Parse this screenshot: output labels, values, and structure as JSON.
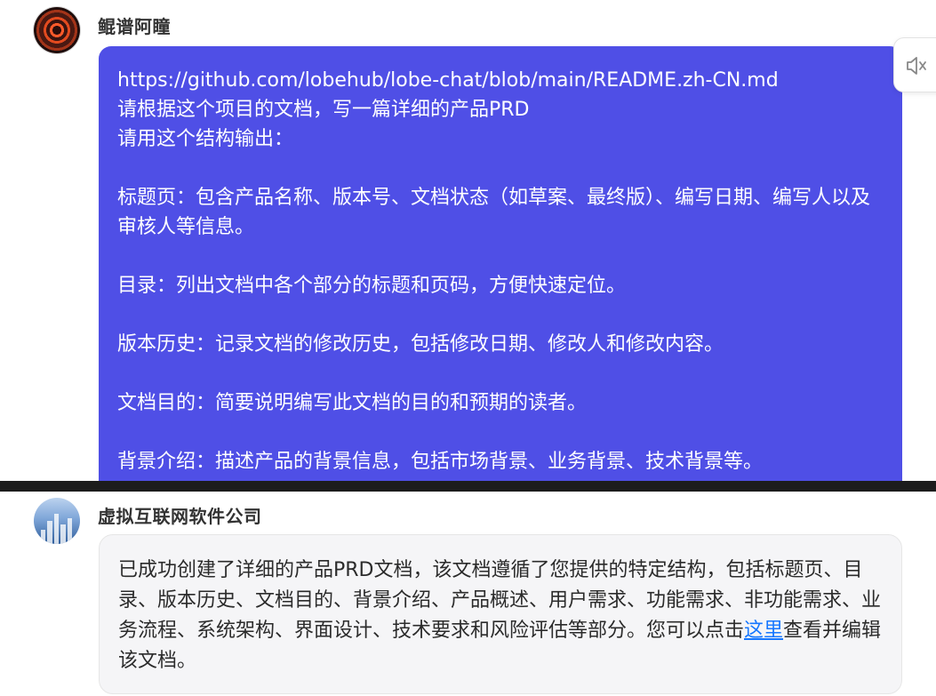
{
  "conversation": {
    "user_message": {
      "sender_name": "鲲谱阿瞳",
      "avatar": "swirl-avatar",
      "lines": [
        "https://github.com/lobehub/lobe-chat/blob/main/README.zh-CN.md",
        "请根据这个项目的文档，写一篇详细的产品PRD",
        "请用这个结构输出：",
        "",
        "标题页：包含产品名称、版本号、文档状态（如草案、最终版）、编写日期、编写人以及审核人等信息。",
        "",
        "目录：列出文档中各个部分的标题和页码，方便快速定位。",
        "",
        "版本历史：记录文档的修改历史，包括修改日期、修改人和修改内容。",
        "",
        "文档目的：简要说明编写此文档的目的和预期的读者。",
        "",
        "背景介绍：描述产品的背景信息，包括市场背景、业务背景、技术背景等。"
      ]
    },
    "side_action": {
      "icon": "speaker-icon"
    },
    "assistant_message": {
      "sender_name": "虚拟互联网软件公司",
      "avatar": "city-skyline-avatar",
      "text_before_link": "已成功创建了详细的产品PRD文档，该文档遵循了您提供的特定结构，包括标题页、目录、版本历史、文档目的、背景介绍、产品概述、用户需求、功能需求、非功能需求、业务流程、系统架构、界面设计、技术要求和风险评估等部分。您可以点击",
      "link_text": "这里",
      "text_after_link": "查看并编辑该文档。"
    }
  },
  "colors": {
    "user_bubble": "#4f4fe6",
    "assistant_bubble": "#f5f5f7",
    "link": "#1677ff",
    "divider": "#1c1c1c"
  }
}
